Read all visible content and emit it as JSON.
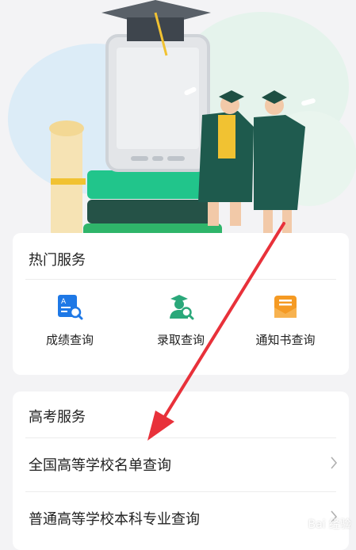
{
  "hot_services": {
    "title": "热门服务",
    "items": [
      {
        "label": "成绩查询",
        "icon": "score-search-icon"
      },
      {
        "label": "录取查询",
        "icon": "admission-search-icon"
      },
      {
        "label": "通知书查询",
        "icon": "notice-letter-icon"
      }
    ]
  },
  "gaokao_services": {
    "title": "高考服务",
    "items": [
      {
        "label": "全国高等学校名单查询"
      },
      {
        "label": "普通高等学校本科专业查询"
      }
    ]
  },
  "colors": {
    "accent_blue": "#1e78e6",
    "accent_green": "#2aa87a",
    "accent_orange": "#f59a23",
    "annotation_red": "#e8313a"
  },
  "watermark": "Bai 经验"
}
